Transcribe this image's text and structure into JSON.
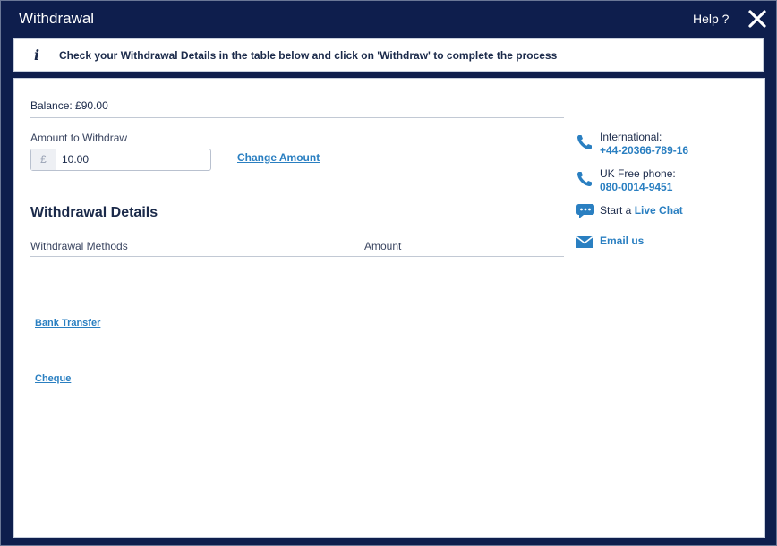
{
  "window": {
    "title": "Withdrawal",
    "help_label": "Help ?",
    "close_icon": "close-icon"
  },
  "info": {
    "icon": "info-icon",
    "icon_glyph": "i",
    "message": "Check your Withdrawal Details in the table below and click on 'Withdraw' to complete the process"
  },
  "balance": {
    "label": "Balance:",
    "value": "£90.00"
  },
  "amount": {
    "label": "Amount to Withdraw",
    "currency": "£",
    "value": "10.00",
    "change_label": "Change Amount"
  },
  "details": {
    "heading": "Withdrawal Details",
    "columns": [
      "Withdrawal Methods",
      "Amount"
    ],
    "methods": [
      "Bank Transfer",
      "Cheque"
    ]
  },
  "contact": {
    "international_label": "International:",
    "international_number": "+44-20366-789-16",
    "uk_label": "UK Free phone:",
    "uk_number": "080-0014-9451",
    "chat_prefix": "Start a",
    "chat_link": "Live Chat",
    "email_label": "Email us"
  },
  "colors": {
    "header_bg": "#0e1e4d",
    "link": "#2a7fc1",
    "text": "#1b2a4a"
  }
}
